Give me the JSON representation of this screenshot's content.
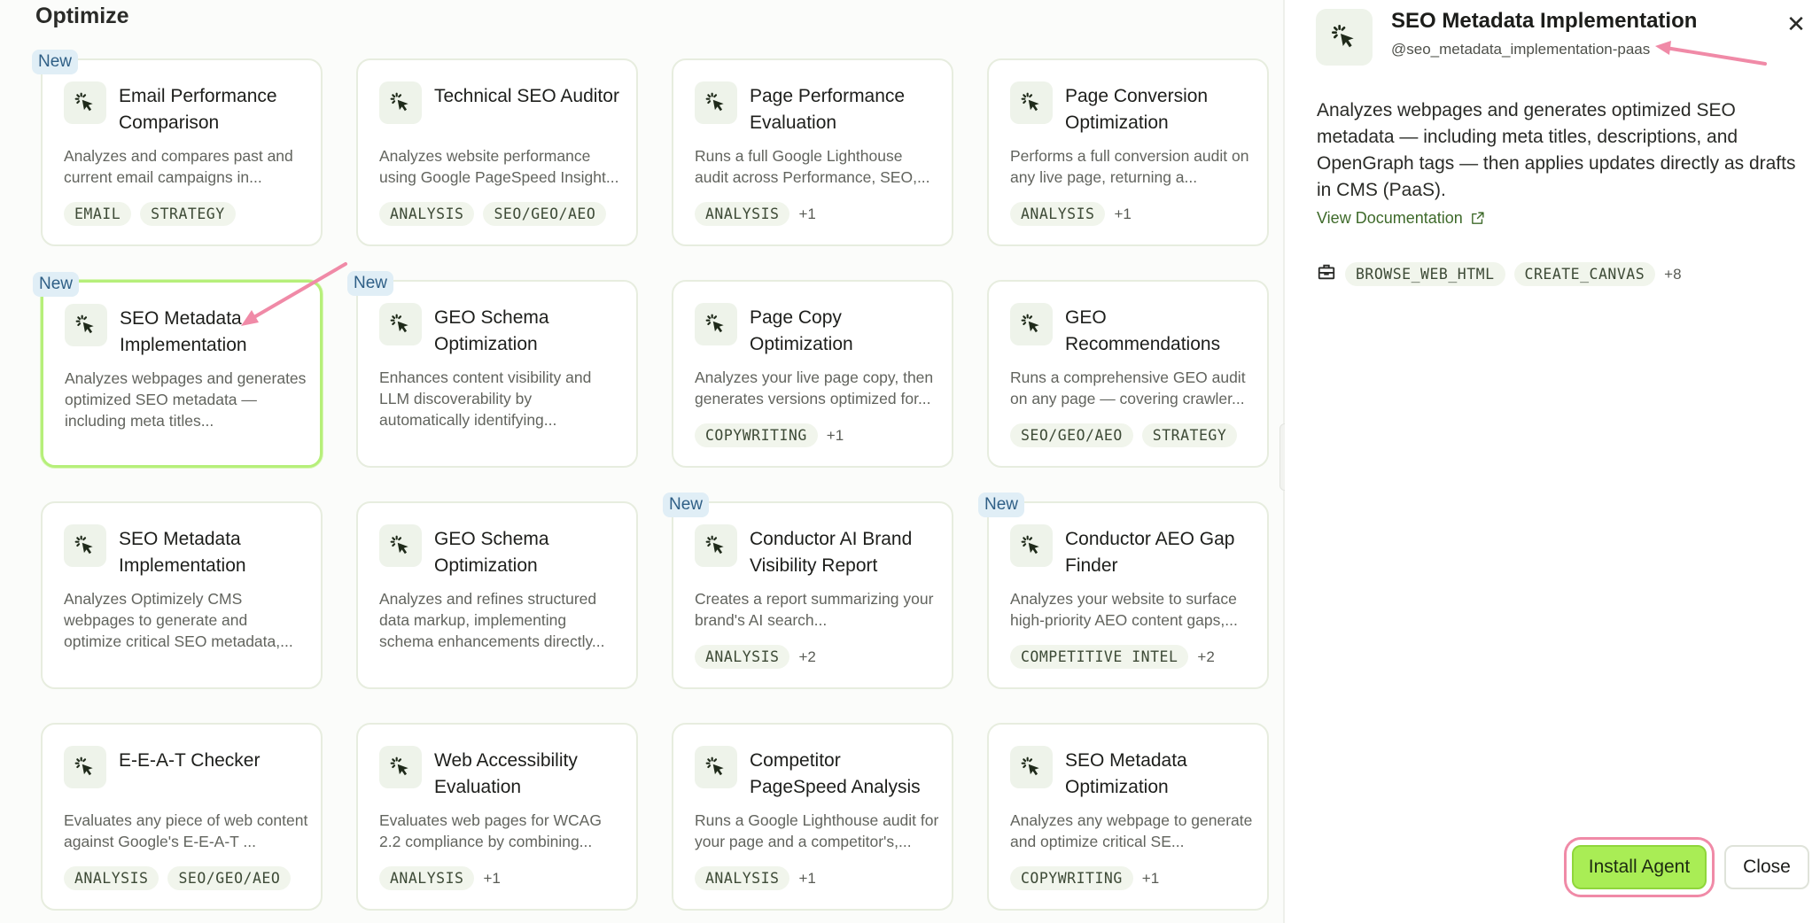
{
  "section_title": "Optimize",
  "new_label": "New",
  "cards": [
    {
      "title": "Email Performance Comparison",
      "desc": "Analyzes and compares past and current email campaigns in...",
      "tags": [
        "EMAIL",
        "STRATEGY"
      ],
      "more": "",
      "is_new": true
    },
    {
      "title": "Technical SEO Auditor",
      "desc": "Analyzes website performance using Google PageSpeed Insight...",
      "tags": [
        "ANALYSIS",
        "SEO/GEO/AEO"
      ],
      "more": "",
      "is_new": false
    },
    {
      "title": "Page Performance Evaluation",
      "desc": "Runs a full Google Lighthouse audit across Performance, SEO,...",
      "tags": [
        "ANALYSIS"
      ],
      "more": "+1",
      "is_new": false
    },
    {
      "title": "Page Conversion Optimization",
      "desc": "Performs a full conversion audit on any live page, returning a...",
      "tags": [
        "ANALYSIS"
      ],
      "more": "+1",
      "is_new": false
    },
    {
      "title": "SEO Metadata Implementation",
      "desc": "Analyzes webpages and generates optimized SEO metadata — including meta titles...",
      "tags": [],
      "more": "",
      "is_new": true,
      "selected": true
    },
    {
      "title": "GEO Schema Optimization",
      "desc": "Enhances content visibility and LLM discoverability by automatically identifying...",
      "tags": [],
      "more": "",
      "is_new": true
    },
    {
      "title": "Page Copy Optimization",
      "desc": "Analyzes your live page copy, then generates versions optimized for...",
      "tags": [
        "COPYWRITING"
      ],
      "more": "+1",
      "is_new": false
    },
    {
      "title": "GEO Recommendations",
      "desc": "Runs a comprehensive GEO audit on any page — covering crawler...",
      "tags": [
        "SEO/GEO/AEO",
        "STRATEGY"
      ],
      "more": "",
      "is_new": false
    },
    {
      "title": "SEO Metadata Implementation",
      "desc": "Analyzes Optimizely CMS webpages to generate and optimize critical SEO metadata,...",
      "tags": [],
      "more": "",
      "is_new": false
    },
    {
      "title": "GEO Schema Optimization",
      "desc": "Analyzes and refines structured data markup, implementing schema enhancements directly...",
      "tags": [],
      "more": "",
      "is_new": false
    },
    {
      "title": "Conductor AI Brand Visibility Report",
      "desc": "Creates a report summarizing your brand's AI search...",
      "tags": [
        "ANALYSIS"
      ],
      "more": "+2",
      "is_new": true
    },
    {
      "title": "Conductor AEO Gap Finder",
      "desc": "Analyzes your website to surface high-priority AEO content gaps,...",
      "tags": [
        "COMPETITIVE INTEL"
      ],
      "more": "+2",
      "is_new": true
    },
    {
      "title": "E-E-A-T Checker",
      "desc": "Evaluates any piece of web content against Google's E-E-A-T ...",
      "tags": [
        "ANALYSIS",
        "SEO/GEO/AEO"
      ],
      "more": "",
      "is_new": false
    },
    {
      "title": "Web Accessibility Evaluation",
      "desc": "Evaluates web pages for WCAG 2.2 compliance by combining...",
      "tags": [
        "ANALYSIS"
      ],
      "more": "+1",
      "is_new": false
    },
    {
      "title": "Competitor PageSpeed Analysis",
      "desc": "Runs a Google Lighthouse audit for your page and a competitor's,...",
      "tags": [
        "ANALYSIS"
      ],
      "more": "+1",
      "is_new": false
    },
    {
      "title": "SEO Metadata Optimization",
      "desc": "Analyzes any webpage to generate and optimize critical SE...",
      "tags": [
        "COPYWRITING"
      ],
      "more": "+1",
      "is_new": false
    }
  ],
  "detail": {
    "title": "SEO Metadata Implementation",
    "handle": "@seo_metadata_implementation-paas",
    "close_symbol": "✕",
    "description": "Analyzes webpages and generates optimized SEO metadata — including meta titles, descriptions, and OpenGraph tags — then applies updates directly as drafts in CMS (PaaS).",
    "doc_link": "View Documentation",
    "tools": [
      "BROWSE_WEB_HTML",
      "CREATE_CANVAS"
    ],
    "tools_more": "+8"
  },
  "buttons": {
    "install": "Install Agent",
    "close": "Close"
  },
  "icons": {
    "agent": "sparkle-cursor-icon",
    "external": "external-link-icon",
    "toolbox": "toolbox-icon",
    "close": "close-icon"
  },
  "colors": {
    "accent_green": "#a9ed55",
    "selected_border": "#b6ef7a",
    "annotation_pink": "#f08aa7",
    "new_badge_bg": "#e0eef6",
    "link_green": "#3e6a2a"
  }
}
